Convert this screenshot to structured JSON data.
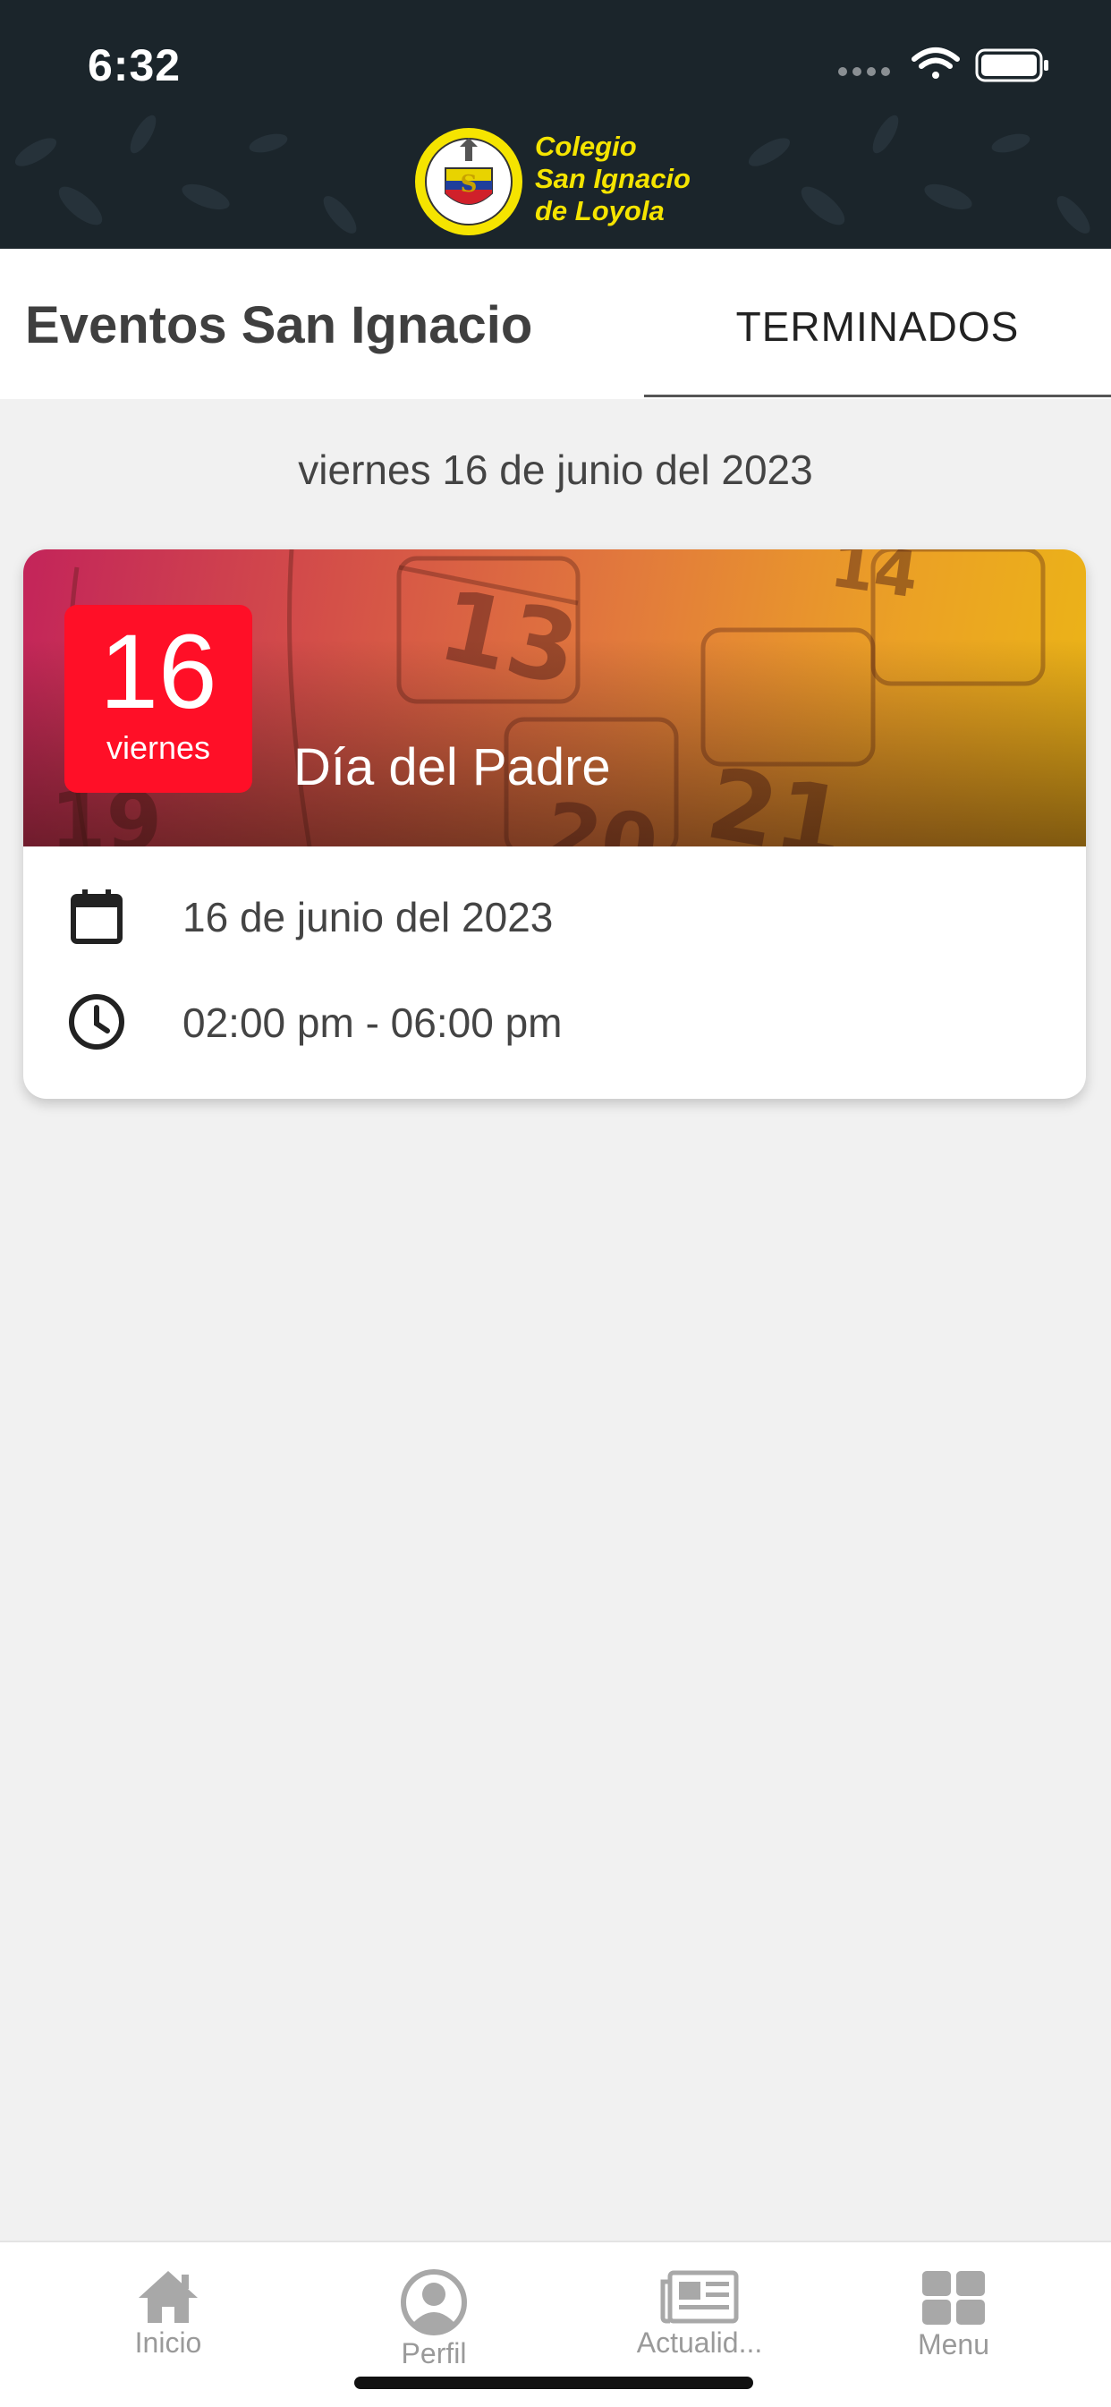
{
  "status_bar": {
    "time": "6:32"
  },
  "header": {
    "logo_lines": [
      "Colegio",
      "San Ignacio",
      "de Loyola"
    ],
    "logo_color": "#f5e400",
    "background": "#1b252b"
  },
  "tabs": {
    "title": "Eventos San Ignacio",
    "active_tab": "TERMINADOS"
  },
  "date_heading": "viernes 16 de junio del 2023",
  "event": {
    "day_number": "16",
    "day_name": "viernes",
    "title": "Día del Padre",
    "date": "16 de junio del 2023",
    "time": "02:00 pm - 06:00 pm",
    "badge_color": "#ff0f27"
  },
  "bottom_nav": {
    "items": [
      {
        "label": "Inicio",
        "icon": "home-icon"
      },
      {
        "label": "Perfil",
        "icon": "profile-icon"
      },
      {
        "label": "Actualid...",
        "icon": "newspaper-icon"
      },
      {
        "label": "Menu",
        "icon": "grid-icon"
      }
    ]
  }
}
